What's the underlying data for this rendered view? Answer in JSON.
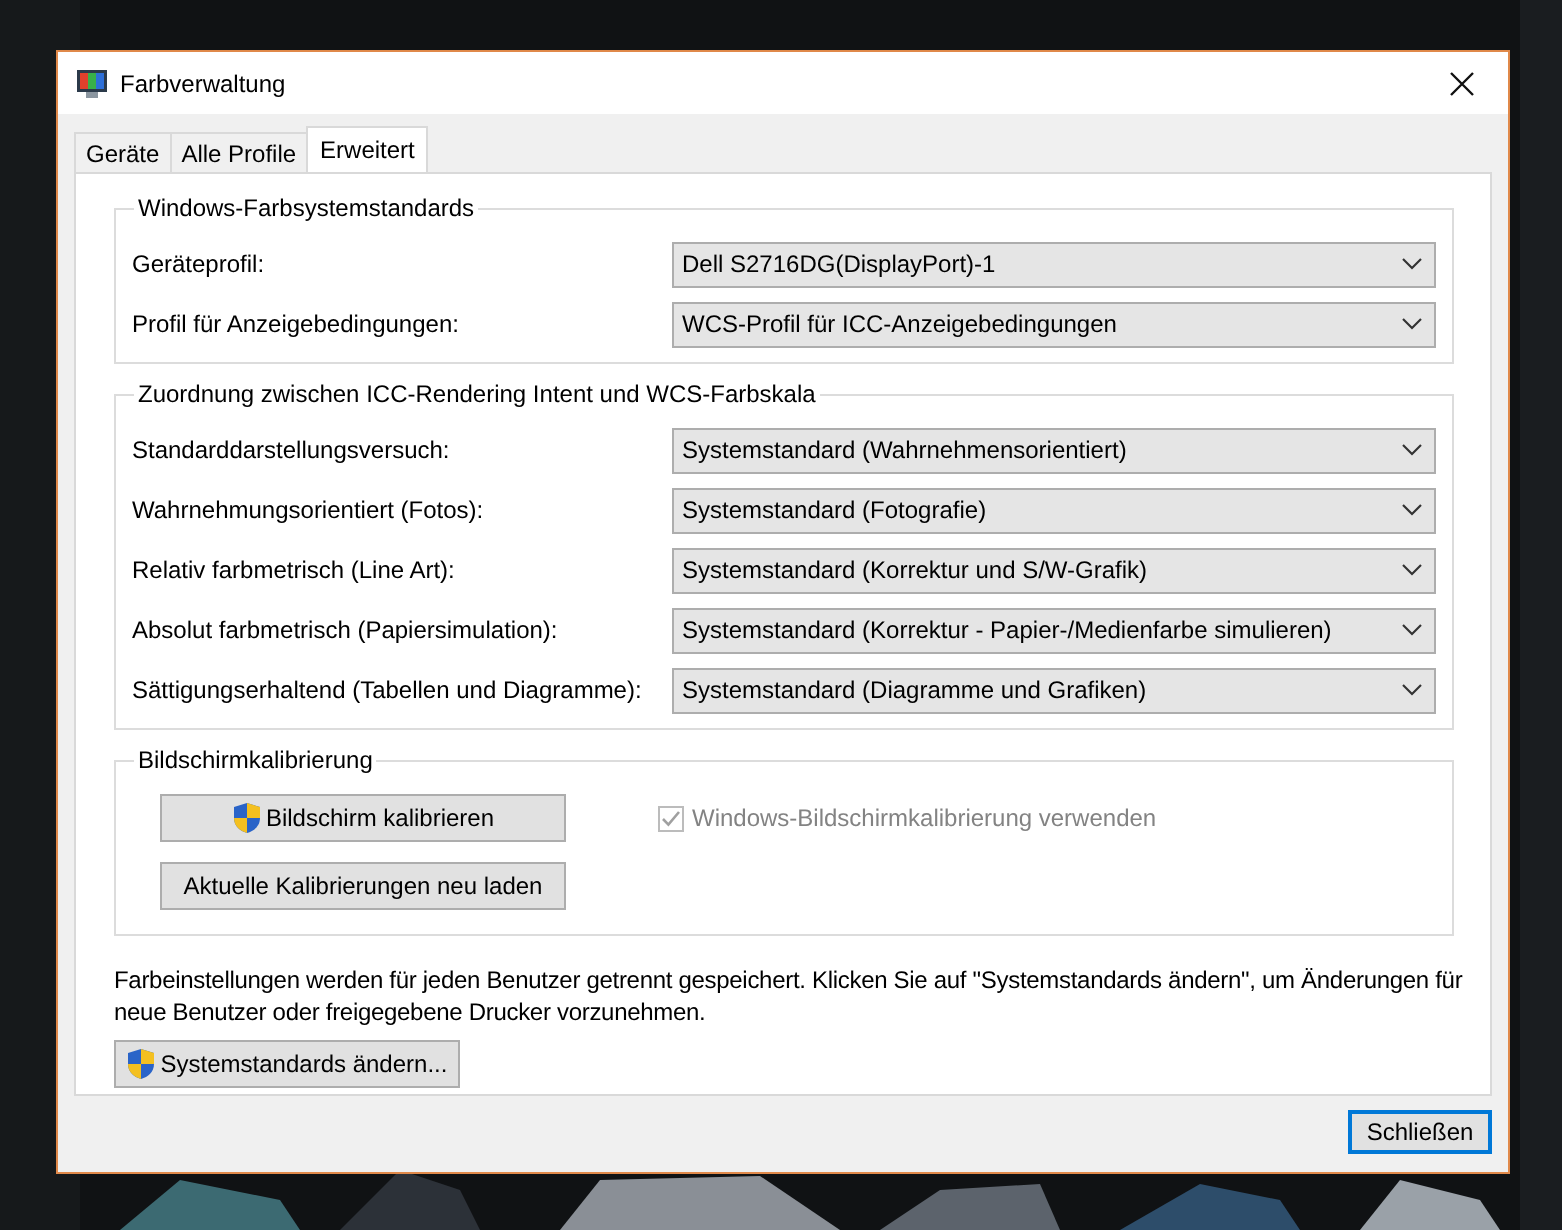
{
  "window": {
    "title": "Farbverwaltung"
  },
  "tabs": [
    {
      "label": "Geräte",
      "selected": false
    },
    {
      "label": "Alle Profile",
      "selected": false
    },
    {
      "label": "Erweitert",
      "selected": true
    }
  ],
  "groups": [
    {
      "title": "Windows-Farbsystemstandards",
      "rows": [
        {
          "label": "Geräteprofil:",
          "value": "Dell S2716DG(DisplayPort)-1"
        },
        {
          "label": "Profil für Anzeigebedingungen:",
          "value": "WCS-Profil für ICC-Anzeigebedingungen"
        }
      ]
    },
    {
      "title": "Zuordnung zwischen ICC-Rendering Intent und WCS-Farbskala",
      "rows": [
        {
          "label": "Standarddarstellungsversuch:",
          "value": "Systemstandard (Wahrnehmensorientiert)"
        },
        {
          "label": "Wahrnehmungsorientiert (Fotos):",
          "value": "Systemstandard (Fotografie)"
        },
        {
          "label": "Relativ farbmetrisch (Line Art):",
          "value": "Systemstandard (Korrektur und S/W-Grafik)"
        },
        {
          "label": "Absolut farbmetrisch (Papiersimulation):",
          "value": "Systemstandard (Korrektur - Papier-/Medienfarbe simulieren)"
        },
        {
          "label": "Sättigungserhaltend (Tabellen und Diagramme):",
          "value": "Systemstandard (Diagramme und Grafiken)"
        }
      ]
    }
  ],
  "calibration": {
    "title": "Bildschirmkalibrierung",
    "buttons": [
      {
        "label": "Bildschirm kalibrieren",
        "kind": "shield"
      },
      {
        "label": "Aktuelle Kalibrierungen neu laden",
        "kind": "plain"
      }
    ],
    "checkbox": {
      "label": "Windows-Bildschirmkalibrierung verwenden",
      "checked": true,
      "disabled": true
    }
  },
  "note": "Farbeinstellungen werden für jeden Benutzer getrennt gespeichert. Klicken Sie auf \"Systemstandards ändern\", um Änderungen für neue Benutzer oder freigegebene Drucker vorzunehmen.",
  "system_button": {
    "label": "Systemstandards ändern...",
    "kind": "shield"
  },
  "close_button": {
    "label": "Schließen"
  }
}
